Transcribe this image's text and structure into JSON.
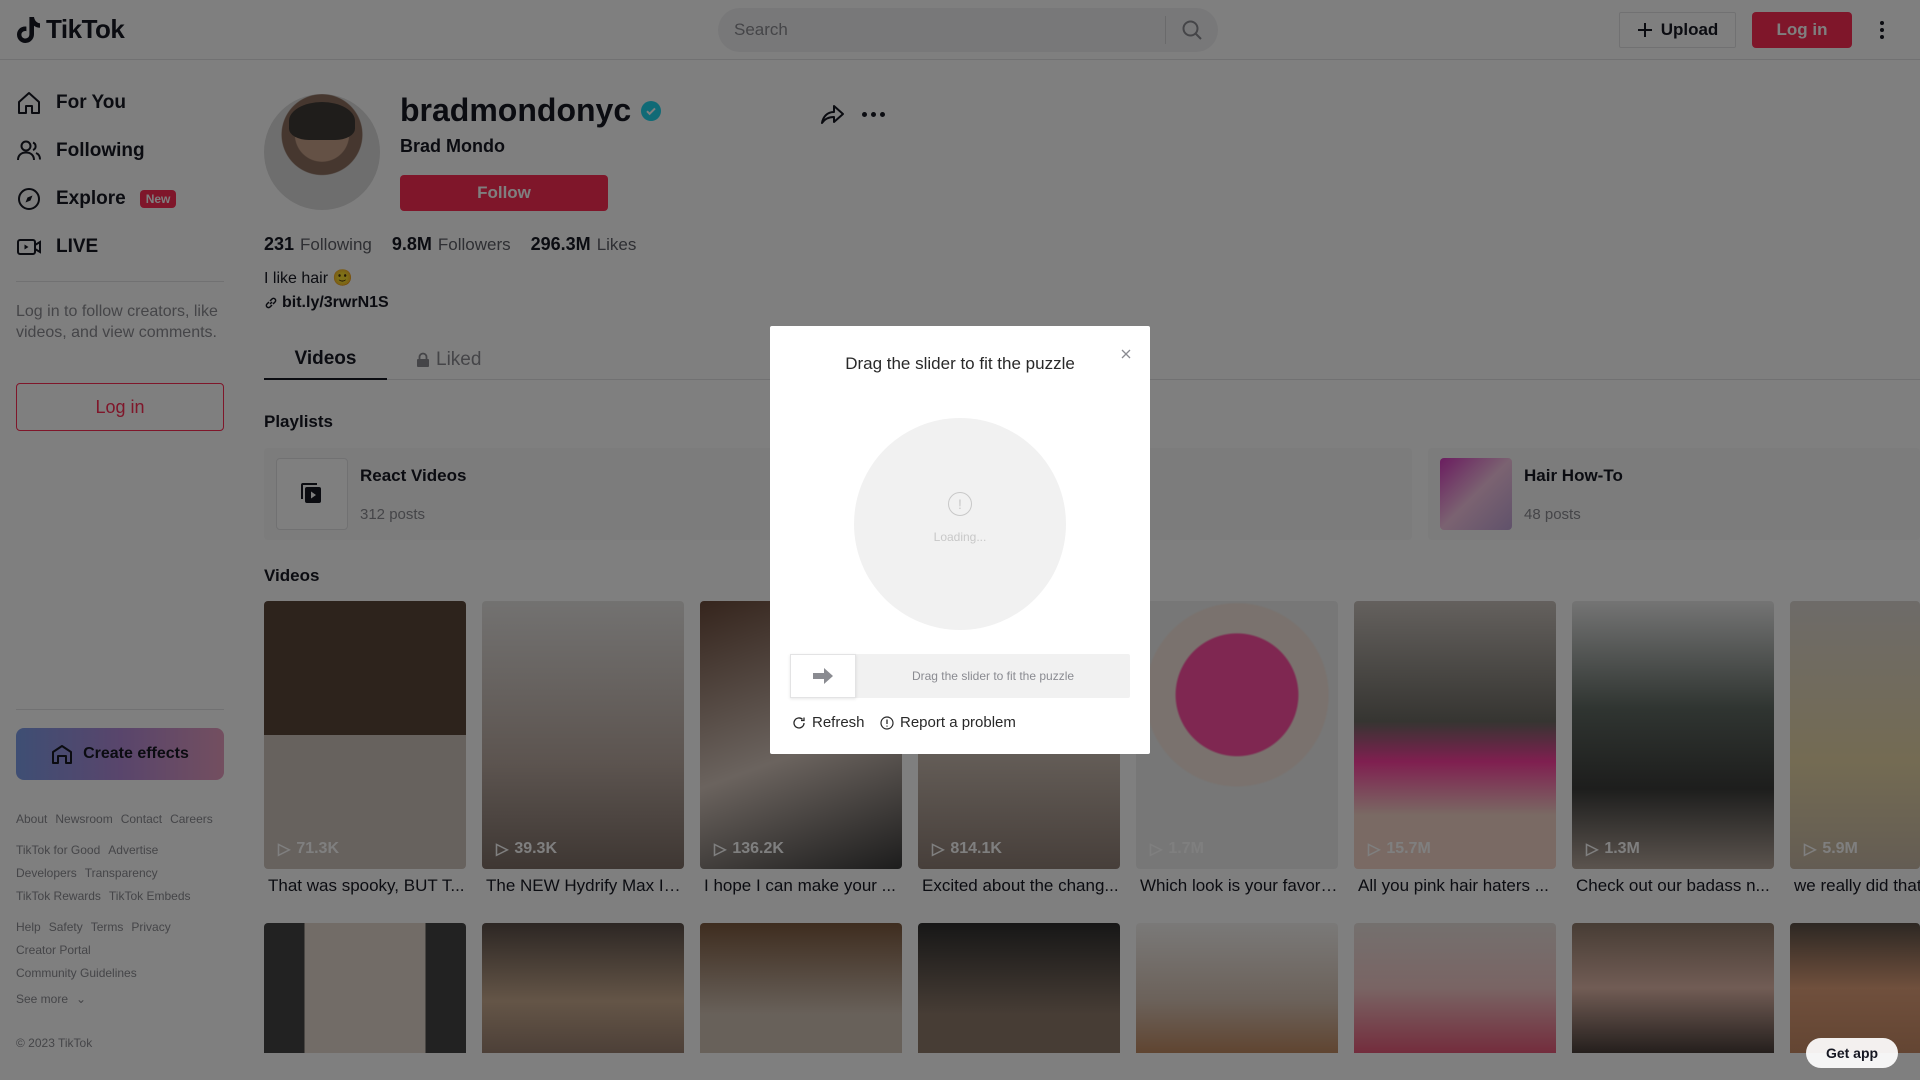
{
  "header": {
    "logo_text": "TikTok",
    "search_placeholder": "Search",
    "upload_label": "Upload",
    "login_label": "Log in"
  },
  "sidebar": {
    "nav": [
      {
        "label": "For You",
        "icon": "home-icon"
      },
      {
        "label": "Following",
        "icon": "users-icon"
      },
      {
        "label": "Explore",
        "icon": "compass-icon",
        "badge": "New"
      },
      {
        "label": "LIVE",
        "icon": "live-icon"
      }
    ],
    "login_prompt": "Log in to follow creators, like videos, and view comments.",
    "login_button": "Log in",
    "create_effects": "Create effects",
    "footer_rows": [
      [
        "About",
        "Newsroom",
        "Contact",
        "Careers"
      ],
      [
        "TikTok for Good",
        "Advertise"
      ],
      [
        "Developers",
        "Transparency"
      ],
      [
        "TikTok Rewards",
        "TikTok Embeds"
      ],
      [
        "Help",
        "Safety",
        "Terms",
        "Privacy"
      ],
      [
        "Creator Portal"
      ],
      [
        "Community Guidelines"
      ]
    ],
    "see_more": "See more",
    "copyright": "© 2023 TikTok"
  },
  "profile": {
    "username": "bradmondonyc",
    "display_name": "Brad Mondo",
    "follow_label": "Follow",
    "following_count": "231",
    "following_label": "Following",
    "followers_count": "9.8M",
    "followers_label": "Followers",
    "likes_count": "296.3M",
    "likes_label": "Likes",
    "bio": "I like hair 🙂",
    "link": "bit.ly/3rwrN1S"
  },
  "tabs": {
    "videos": "Videos",
    "liked": "Liked"
  },
  "playlists": {
    "title": "Playlists",
    "items": [
      {
        "name": "React Videos",
        "posts": "312 posts"
      },
      {
        "name": "Hair How-To",
        "posts": "48 posts"
      }
    ]
  },
  "videos": {
    "title": "Videos",
    "row1": [
      {
        "views": "71.3K",
        "caption": "That was spooky, BUT T..."
      },
      {
        "views": "39.3K",
        "caption": "The NEW Hydrify Max Int..."
      },
      {
        "views": "136.2K",
        "caption": "I hope I can make your ..."
      },
      {
        "views": "814.1K",
        "caption": "Excited about the chang..."
      },
      {
        "views": "1.7M",
        "caption": "Which look is your favori..."
      },
      {
        "views": "15.7M",
        "caption": "All you pink hair haters ..."
      },
      {
        "views": "1.3M",
        "caption": "Check out our badass n..."
      },
      {
        "views": "5.9M",
        "caption": "we really did that"
      }
    ]
  },
  "captcha": {
    "title": "Drag the slider to fit the puzzle",
    "loading": "Loading...",
    "slider_hint": "Drag the slider to fit the puzzle",
    "refresh": "Refresh",
    "report": "Report a problem"
  },
  "get_app": "Get app",
  "colors": {
    "brand": "#fe2c55",
    "verified": "#20d5ec"
  }
}
